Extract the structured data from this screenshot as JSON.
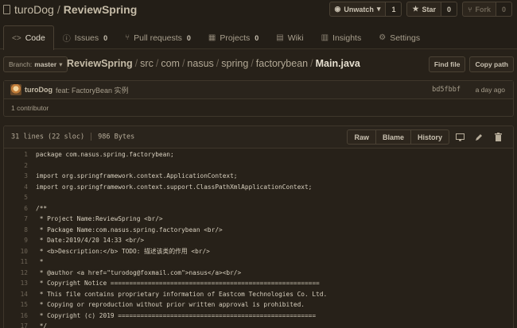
{
  "repo": {
    "owner": "turoDog",
    "name": "ReviewSpring"
  },
  "actions": [
    {
      "icon": "eye-icon",
      "label": "Unwatch",
      "caret": "▾",
      "count": "1",
      "disabled": false
    },
    {
      "icon": "star-icon",
      "label": "Star",
      "count": "0",
      "disabled": false
    },
    {
      "icon": "fork-icon",
      "label": "Fork",
      "count": "0",
      "disabled": true
    }
  ],
  "nav": [
    {
      "icon": "code-icon",
      "glyph": "<>",
      "label": "Code",
      "count": "",
      "selected": true
    },
    {
      "icon": "issues-icon",
      "glyph": "ⓘ",
      "label": "Issues",
      "count": "0"
    },
    {
      "icon": "pull-request-icon",
      "glyph": "⑂",
      "label": "Pull requests",
      "count": "0"
    },
    {
      "icon": "projects-icon",
      "glyph": "▦",
      "label": "Projects",
      "count": "0"
    },
    {
      "icon": "wiki-icon",
      "glyph": "▤",
      "label": "Wiki",
      "count": ""
    },
    {
      "icon": "insights-icon",
      "glyph": "▥",
      "label": "Insights",
      "count": ""
    },
    {
      "icon": "gear-icon",
      "glyph": "⚙",
      "label": "Settings",
      "count": ""
    }
  ],
  "branch": {
    "prefix": "Branch:",
    "name": "master",
    "caret": "▾"
  },
  "breadcrumb": {
    "root": "ReviewSpring",
    "segments": [
      "src",
      "com",
      "nasus",
      "spring",
      "factorybean"
    ],
    "file": "Main.java",
    "sep": "/"
  },
  "file_actions": {
    "find": "Find file",
    "copy": "Copy path"
  },
  "commit": {
    "author": "turoDog",
    "message": "feat:  FactoryBean 实例",
    "sha": "bd5fbbf",
    "age": "a day ago",
    "contributors": "1 contributor"
  },
  "file": {
    "lines_info": "31 lines (22 sloc)",
    "size": "986 Bytes",
    "buttons": [
      "Raw",
      "Blame",
      "History"
    ],
    "icons": [
      "desktop-icon",
      "pencil-icon",
      "trash-icon"
    ]
  },
  "code": [
    {
      "n": "1",
      "t": "package com.nasus.spring.factorybean;"
    },
    {
      "n": "2",
      "t": ""
    },
    {
      "n": "3",
      "t": "import org.springframework.context.ApplicationContext;"
    },
    {
      "n": "4",
      "t": "import org.springframework.context.support.ClassPathXmlApplicationContext;"
    },
    {
      "n": "5",
      "t": ""
    },
    {
      "n": "6",
      "t": "/**"
    },
    {
      "n": "7",
      "t": " * Project Name:ReviewSpring <br/>"
    },
    {
      "n": "8",
      "t": " * Package Name:com.nasus.spring.factorybean <br/>"
    },
    {
      "n": "9",
      "t": " * Date:2019/4/20 14:33 <br/>"
    },
    {
      "n": "10",
      "t": " * <b>Description:</b> TODO: 描述该类的作用 <br/>"
    },
    {
      "n": "11",
      "t": " *"
    },
    {
      "n": "12",
      "t": " * @author <a href=\"turodog@foxmail.com\">nasus</a><br/>"
    },
    {
      "n": "13",
      "t": " * Copyright Notice ========================================================"
    },
    {
      "n": "14",
      "t": " * This file contains proprietary information of Eastcom Technologies Co. Ltd."
    },
    {
      "n": "15",
      "t": " * Copying or reproduction without prior written approval is prohibited."
    },
    {
      "n": "16",
      "t": " * Copyright (c) 2019 ====================================================="
    },
    {
      "n": "17",
      "t": " */"
    }
  ]
}
